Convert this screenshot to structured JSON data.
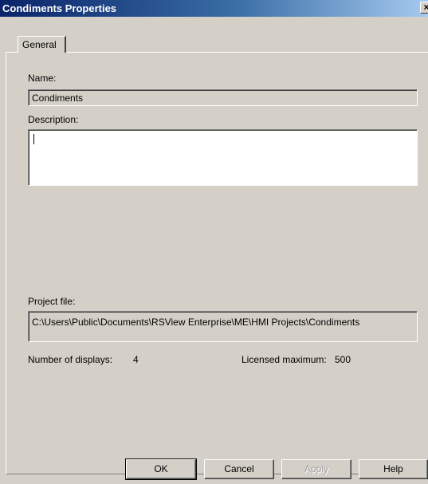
{
  "window": {
    "title": "Condiments Properties",
    "close_glyph": "×"
  },
  "tabs": [
    {
      "label": "General",
      "active": true
    }
  ],
  "general": {
    "name_label": "Name:",
    "name_value": "Condiments",
    "description_label": "Description:",
    "description_value": "",
    "project_file_label": "Project file:",
    "project_file_value": "C:\\Users\\Public\\Documents\\RSView Enterprise\\ME\\HMI Projects\\Condiments",
    "displays_label": "Number of displays:",
    "displays_value": "4",
    "licensed_label": "Licensed maximum:",
    "licensed_value": "500"
  },
  "buttons": {
    "ok": "OK",
    "cancel": "Cancel",
    "apply": "Apply",
    "help": "Help"
  },
  "colors": {
    "face": "#d4d0c8",
    "title_start": "#0a246a",
    "title_end": "#a6caf0"
  }
}
